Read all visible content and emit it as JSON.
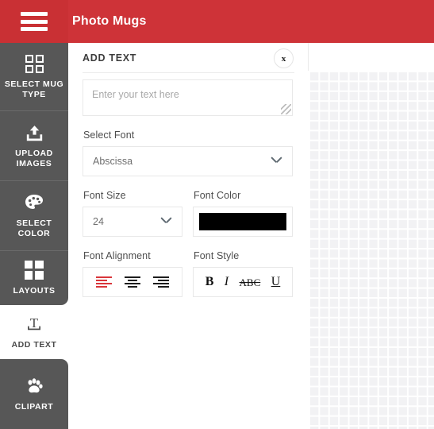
{
  "topbar": {
    "menu_icon": "hamburger-menu-icon",
    "title": "Photo Mugs",
    "background_color": "#ce3338"
  },
  "sidebar": {
    "items": [
      {
        "id": "select-mug-type",
        "label": "SELECT MUG TYPE",
        "icon": "grid-four-squares-icon",
        "active": false
      },
      {
        "id": "upload-images",
        "label": "UPLOAD IMAGES",
        "icon": "upload-icon",
        "active": false
      },
      {
        "id": "select-color",
        "label": "SELECT COLOR",
        "icon": "paint-palette-icon",
        "active": false
      },
      {
        "id": "layouts",
        "label": "LAYOUTS",
        "icon": "layouts-grid-icon",
        "active": false
      },
      {
        "id": "add-text",
        "label": "ADD TEXT",
        "icon": "text-t-icon",
        "active": true
      },
      {
        "id": "clipart",
        "label": "CLIPART",
        "icon": "paw-print-icon",
        "active": false
      }
    ]
  },
  "panel": {
    "title": "ADD TEXT",
    "close_label": "x",
    "text_input": {
      "placeholder": "Enter your text here",
      "value": ""
    },
    "font": {
      "label": "Select Font",
      "value": "Abscissa"
    },
    "font_size": {
      "label": "Font Size",
      "value": "24"
    },
    "font_color": {
      "label": "Font Color",
      "value": "#000000"
    },
    "font_alignment": {
      "label": "Font Alignment",
      "options": [
        {
          "id": "align-left",
          "icon": "align-left-icon",
          "active": true
        },
        {
          "id": "align-center",
          "icon": "align-center-icon",
          "active": false
        },
        {
          "id": "align-right",
          "icon": "align-right-icon",
          "active": false
        }
      ],
      "active_color": "#d9363b"
    },
    "font_style": {
      "label": "Font Style",
      "options": [
        {
          "id": "bold",
          "label": "B",
          "active": false
        },
        {
          "id": "italic",
          "label": "I",
          "active": false
        },
        {
          "id": "strikethrough",
          "label": "ABC",
          "active": false
        },
        {
          "id": "underline",
          "label": "U",
          "active": false
        }
      ]
    }
  },
  "canvas": {
    "name": "design-canvas-grid"
  }
}
